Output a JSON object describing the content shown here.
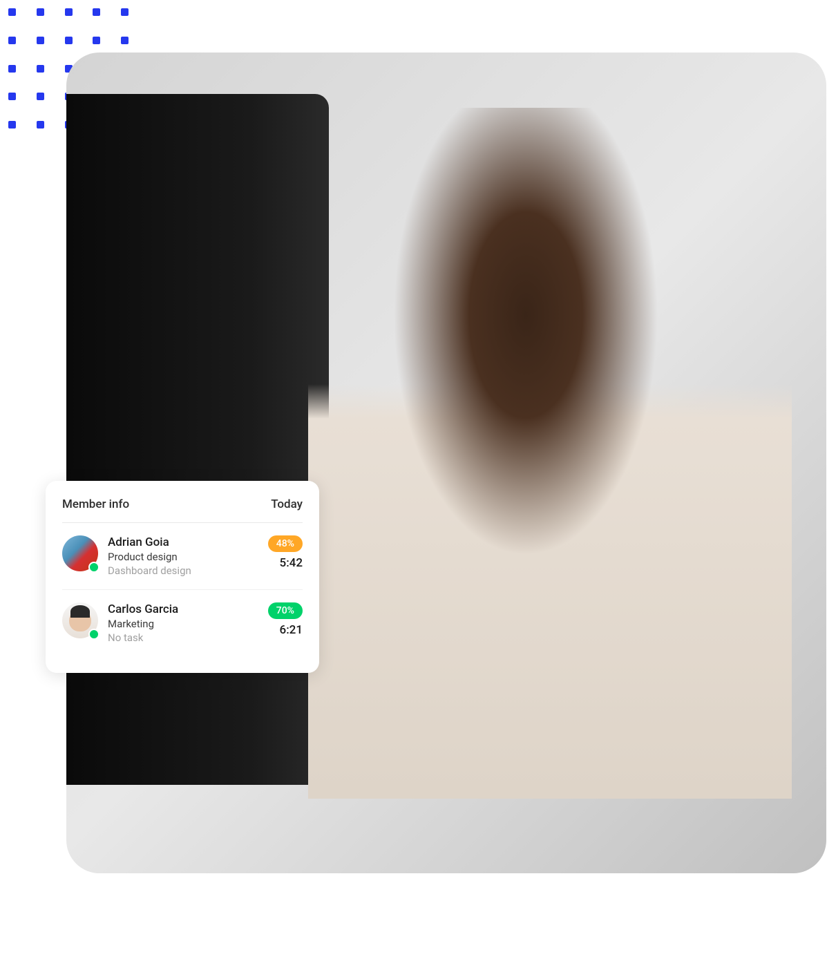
{
  "card": {
    "title": "Member info",
    "date_label": "Today",
    "members": [
      {
        "name": "Adrian Goia",
        "role": "Product design",
        "task": "Dashboard design",
        "percentage": "48%",
        "time": "5:42",
        "badge_color": "orange",
        "status": "online"
      },
      {
        "name": "Carlos Garcia",
        "role": "Marketing",
        "task": "No task",
        "percentage": "70%",
        "time": "6:21",
        "badge_color": "green",
        "status": "online"
      }
    ]
  }
}
